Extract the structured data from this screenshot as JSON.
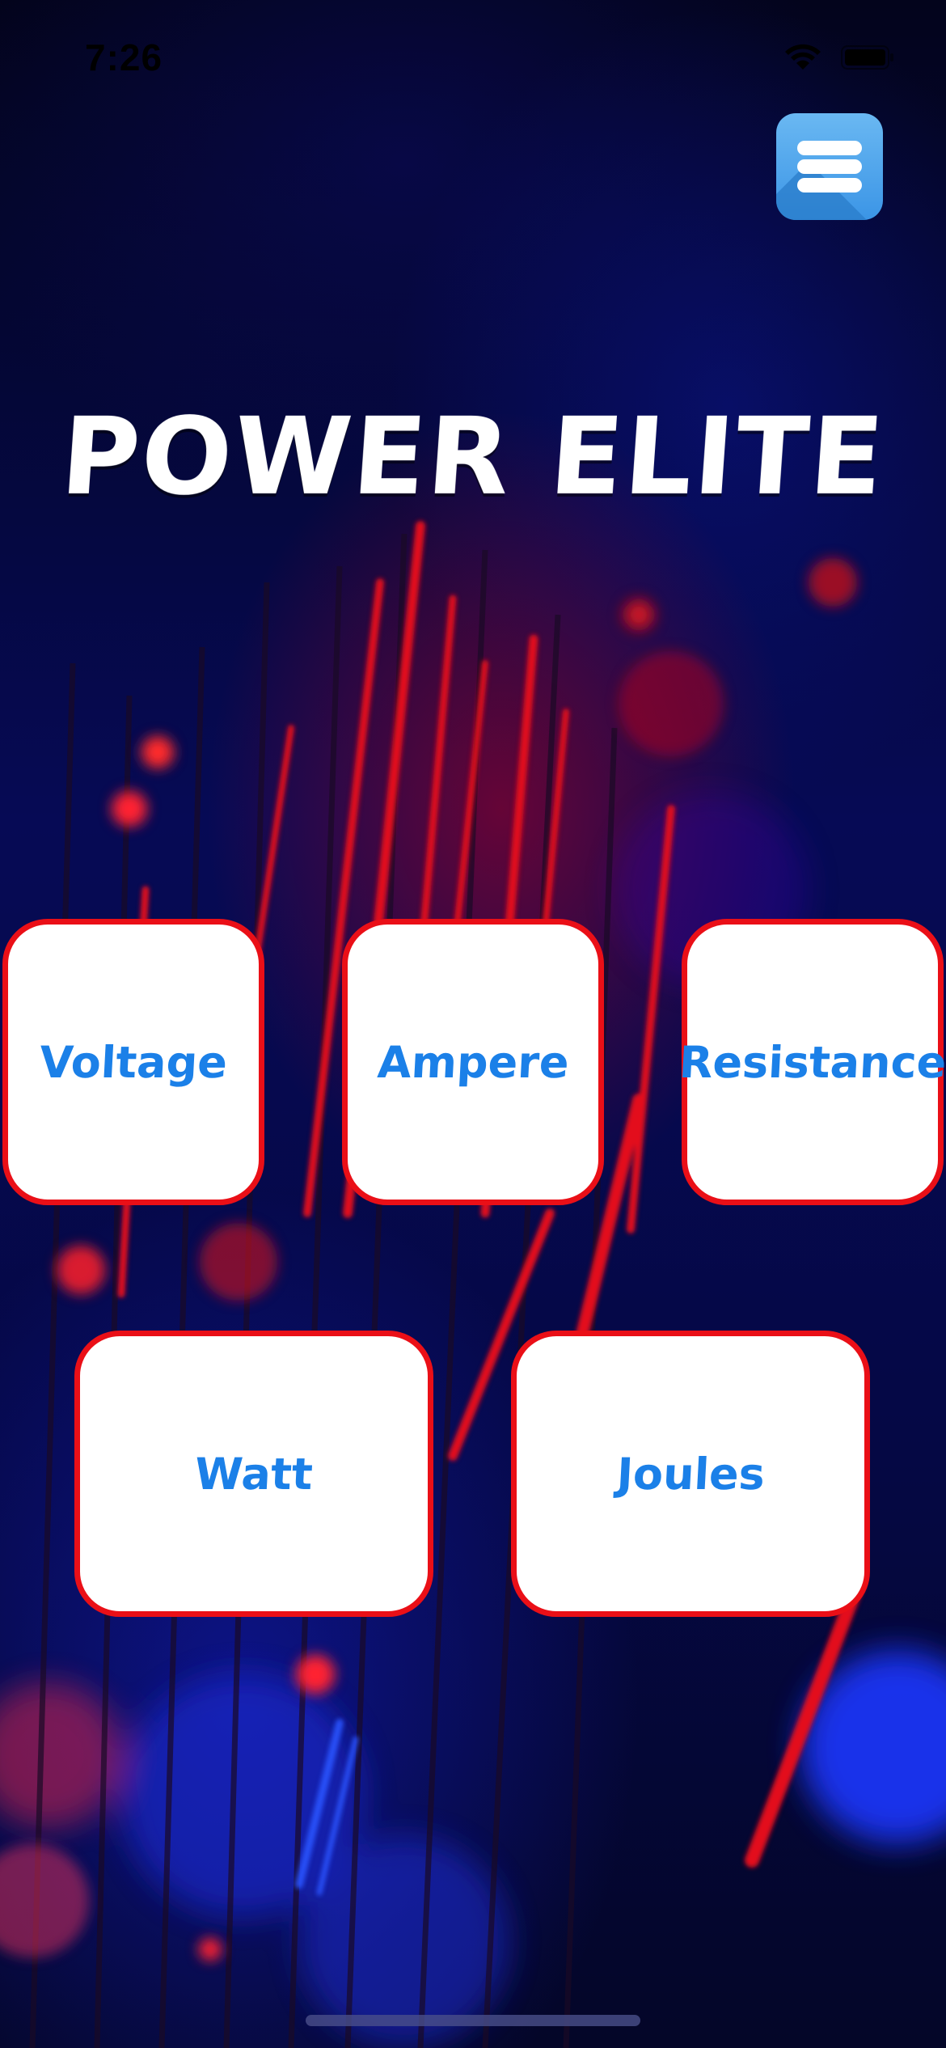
{
  "status_bar": {
    "time": "7:26"
  },
  "menu": {
    "icon": "menu-icon"
  },
  "title": "POWER ELITE",
  "units": [
    {
      "id": "voltage",
      "label": "Voltage"
    },
    {
      "id": "ampere",
      "label": "Ampere"
    },
    {
      "id": "resistance",
      "label": "Resistance"
    },
    {
      "id": "watt",
      "label": "Watt"
    },
    {
      "id": "joules",
      "label": "Joules"
    }
  ],
  "colors": {
    "card_border": "#ea0f17",
    "card_text": "#1b80e8",
    "card_background": "#ffffff",
    "menu_button": "#4aa3ec",
    "title": "#ffffff"
  }
}
